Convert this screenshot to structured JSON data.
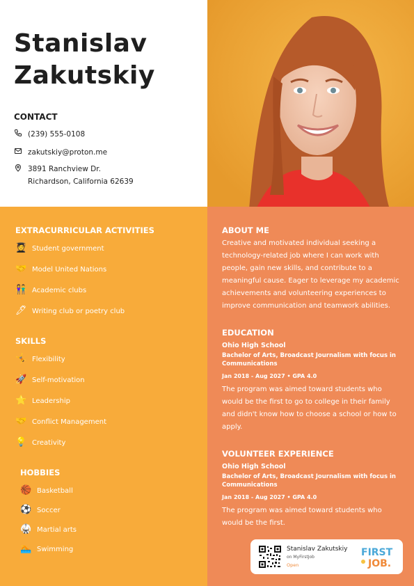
{
  "name": {
    "first": "Stanislav",
    "last": "Zakutskiy"
  },
  "contact": {
    "heading": "CONTACT",
    "phone": "(239) 555-0108",
    "email": "zakutskiy@proton.me",
    "address_line1": "3891 Ranchview Dr.",
    "address_line2": "Richardson, California 62639"
  },
  "extracurricular": {
    "heading": "EXTRACURRICULAR ACTIVITIES",
    "items": [
      "Student government",
      "Model United Nations",
      "Academic clubs",
      "Writing club or poetry club"
    ],
    "icons": [
      "graduate-icon",
      "handshake-icon",
      "people-icon",
      "pen-icon"
    ]
  },
  "skills": {
    "heading": "SKILLS",
    "items": [
      "Flexibility",
      "Self-motivation",
      "Leadership",
      "Conflict Management",
      "Creativity"
    ],
    "icons": [
      "gymnast-icon",
      "rocket-icon",
      "star-icon",
      "handshake-icon",
      "lightbulb-icon"
    ]
  },
  "hobbies": {
    "heading": "HOBBIES",
    "items": [
      "Basketball",
      "Soccer",
      "Martial arts",
      "Swimming"
    ],
    "icons": [
      "basketball-icon",
      "soccer-ball-icon",
      "martial-arts-icon",
      "swimmer-icon"
    ]
  },
  "about": {
    "heading": "ABOUT ME",
    "text": "Creative and motivated individual seeking a technology-related job where I can work with people, gain new skills, and contribute to a meaningful cause. Eager to leverage my academic achievements and volunteering experiences to improve communication and teamwork abilities."
  },
  "education": {
    "heading": "EDUCATION",
    "school": "Ohio High School",
    "degree": "Bachelor of Arts, Broadcast Journalism with focus in Communications",
    "dates": "Jan 2018 - Aug 2027 • GPA 4.0",
    "text": "The program was aimed toward students who would be the first to go to college in their family and didn't know how to choose a school or how to apply."
  },
  "volunteer": {
    "heading": "VOLUNTEER EXPERIENCE",
    "school": "Ohio High School",
    "degree": "Bachelor of Arts, Broadcast Journalism with focus in Communications",
    "dates": "Jan 2018 - Aug 2027 • GPA 4.0",
    "text": "The program was aimed toward students who would be the first."
  },
  "badge": {
    "name": "Stanislav Zakutskiy",
    "sub": "on MyFirstJob",
    "open": "Open",
    "logo_text_1": "FIRST",
    "logo_text_2": "JOB."
  },
  "colors": {
    "left_panel": "#f8ab3a",
    "right_panel": "#ef8a57",
    "photo_bg": "#f0a93a",
    "accent_text": "#1f1f1f"
  }
}
